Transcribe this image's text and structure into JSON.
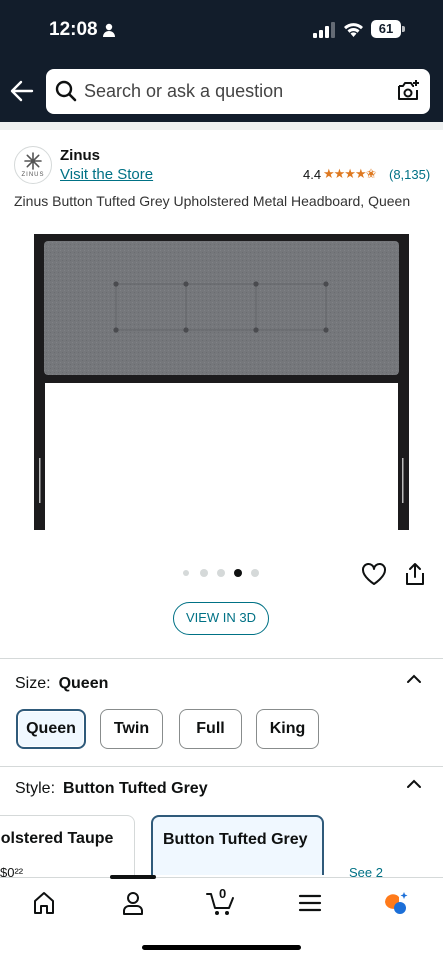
{
  "status_bar": {
    "time": "12:08",
    "battery": "61"
  },
  "search": {
    "placeholder": "Search or ask a question"
  },
  "brand": {
    "logo_text": "ZINUS",
    "name": "Zinus",
    "store_link": "Visit the Store",
    "rating": "4.4",
    "stars": "★★★★✬",
    "review_count": "(8,135)"
  },
  "product": {
    "title": "Zinus Button Tufted Grey Upholstered Metal Headboard, Queen"
  },
  "image_carousel": {
    "total": 5,
    "active_index": 3
  },
  "view_3d_label": "VIEW IN 3D",
  "size": {
    "label": "Size:",
    "selected": "Queen",
    "options": [
      "Queen",
      "Twin",
      "Full",
      "King"
    ]
  },
  "style": {
    "label": "Style:",
    "selected": "Button Tufted Grey",
    "options": [
      "holstered Taupe",
      "Button Tufted Grey"
    ],
    "peek_left": "$0²²",
    "peek_right": "See 2"
  },
  "bottom_nav": {
    "cart_count": "0",
    "items": [
      "home-icon",
      "account-icon",
      "cart-icon",
      "menu-icon",
      "rufus-icon"
    ]
  },
  "colors": {
    "header_bg": "#121d2b",
    "link": "#007185",
    "star": "#de7921",
    "selected_border": "#2f5a7a"
  }
}
